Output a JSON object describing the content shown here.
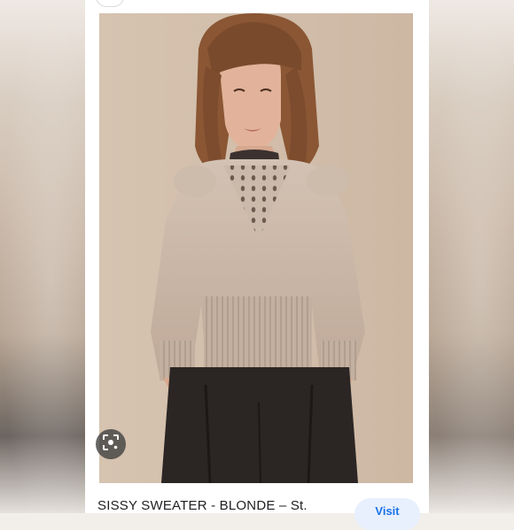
{
  "result": {
    "title": "SISSY SWEATER - BLONDE – St.",
    "visit_label": "Visit"
  },
  "icons": {
    "lens": "lens-icon"
  },
  "colors": {
    "accent": "#1a73e8",
    "visit_bg": "#e8f0fe",
    "photo_backdrop": "#d4c0ad",
    "sweater": "#c7b3a3",
    "trousers": "#2b2624"
  }
}
